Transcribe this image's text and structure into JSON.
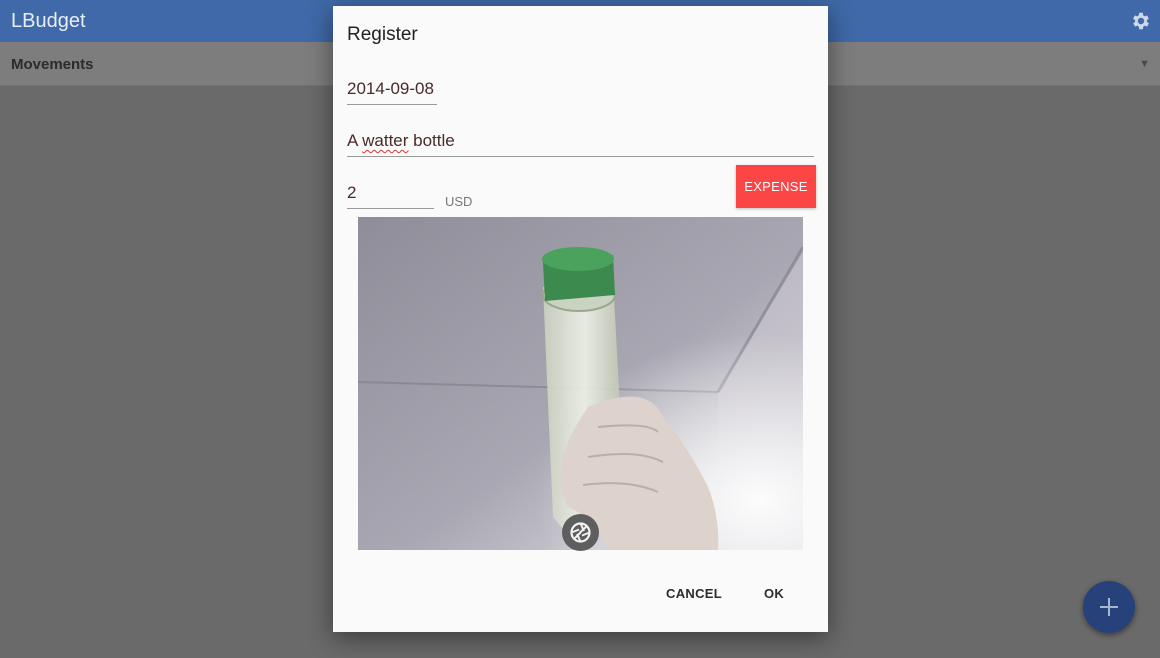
{
  "app": {
    "title": "LBudget",
    "settings_icon": "gear-icon"
  },
  "subbar": {
    "label": "Movements",
    "dropdown_icon": "triangle-down-icon"
  },
  "fab": {
    "icon": "plus-icon"
  },
  "dialog": {
    "title": "Register",
    "date": "2014-09-08",
    "description_before": "A ",
    "description_misspelled": "watter",
    "description_after": " bottle",
    "amount": "2",
    "currency": "USD",
    "type_button": "EXPENSE",
    "shutter_icon": "camera-shutter-icon",
    "cancel_label": "CANCEL",
    "ok_label": "OK"
  },
  "colors": {
    "appbar": "#3f69a8",
    "expense": "#fc4646",
    "fab": "#27427a",
    "dialog": "#fafafa"
  }
}
